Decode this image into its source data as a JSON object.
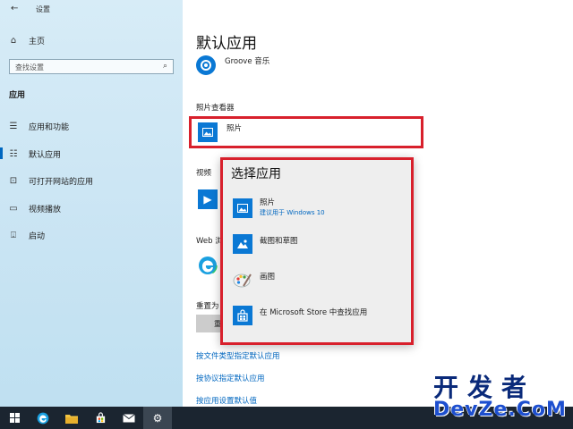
{
  "window": {
    "title": "设置"
  },
  "sidebar": {
    "home_label": "主页",
    "search_placeholder": "查找设置",
    "section_label": "应用",
    "items": [
      {
        "label": "应用和功能",
        "icon": "list-icon"
      },
      {
        "label": "默认应用",
        "icon": "default-apps-icon",
        "active": true
      },
      {
        "label": "可打开网站的应用",
        "icon": "web-apps-icon"
      },
      {
        "label": "视频播放",
        "icon": "video-icon"
      },
      {
        "label": "启动",
        "icon": "startup-icon"
      }
    ]
  },
  "main": {
    "title": "默认应用",
    "music_app": "Groove 音乐",
    "photo_viewer_label": "照片查看器",
    "photo_app": "照片",
    "video_label_partial": "视频",
    "web_label_partial": "Web 浏",
    "reset_label_partial": "重置为",
    "reset_button_partial": "重",
    "links": [
      "按文件类型指定默认应用",
      "按协议指定默认应用",
      "按应用设置默认值"
    ]
  },
  "popup": {
    "title": "选择应用",
    "items": [
      {
        "name": "照片",
        "subtitle": "建议用于 Windows 10",
        "icon": "photos-icon"
      },
      {
        "name": "截图和草图",
        "subtitle": "",
        "icon": "snip-sketch-icon"
      },
      {
        "name": "画图",
        "subtitle": "",
        "icon": "paint-icon"
      },
      {
        "name": "在 Microsoft Store 中查找应用",
        "subtitle": "",
        "icon": "store-icon"
      }
    ]
  },
  "taskbar": {
    "items": [
      "windows-start-icon",
      "edge-icon",
      "file-explorer-icon",
      "store-icon",
      "mail-icon",
      "settings-icon"
    ]
  },
  "watermark": {
    "line1": "开发者",
    "line2": "DevZe.CoM"
  },
  "colors": {
    "accent": "#0067c0",
    "highlight": "#d8202c",
    "tile": "#0a78d4",
    "taskbar": "#1b2530"
  }
}
